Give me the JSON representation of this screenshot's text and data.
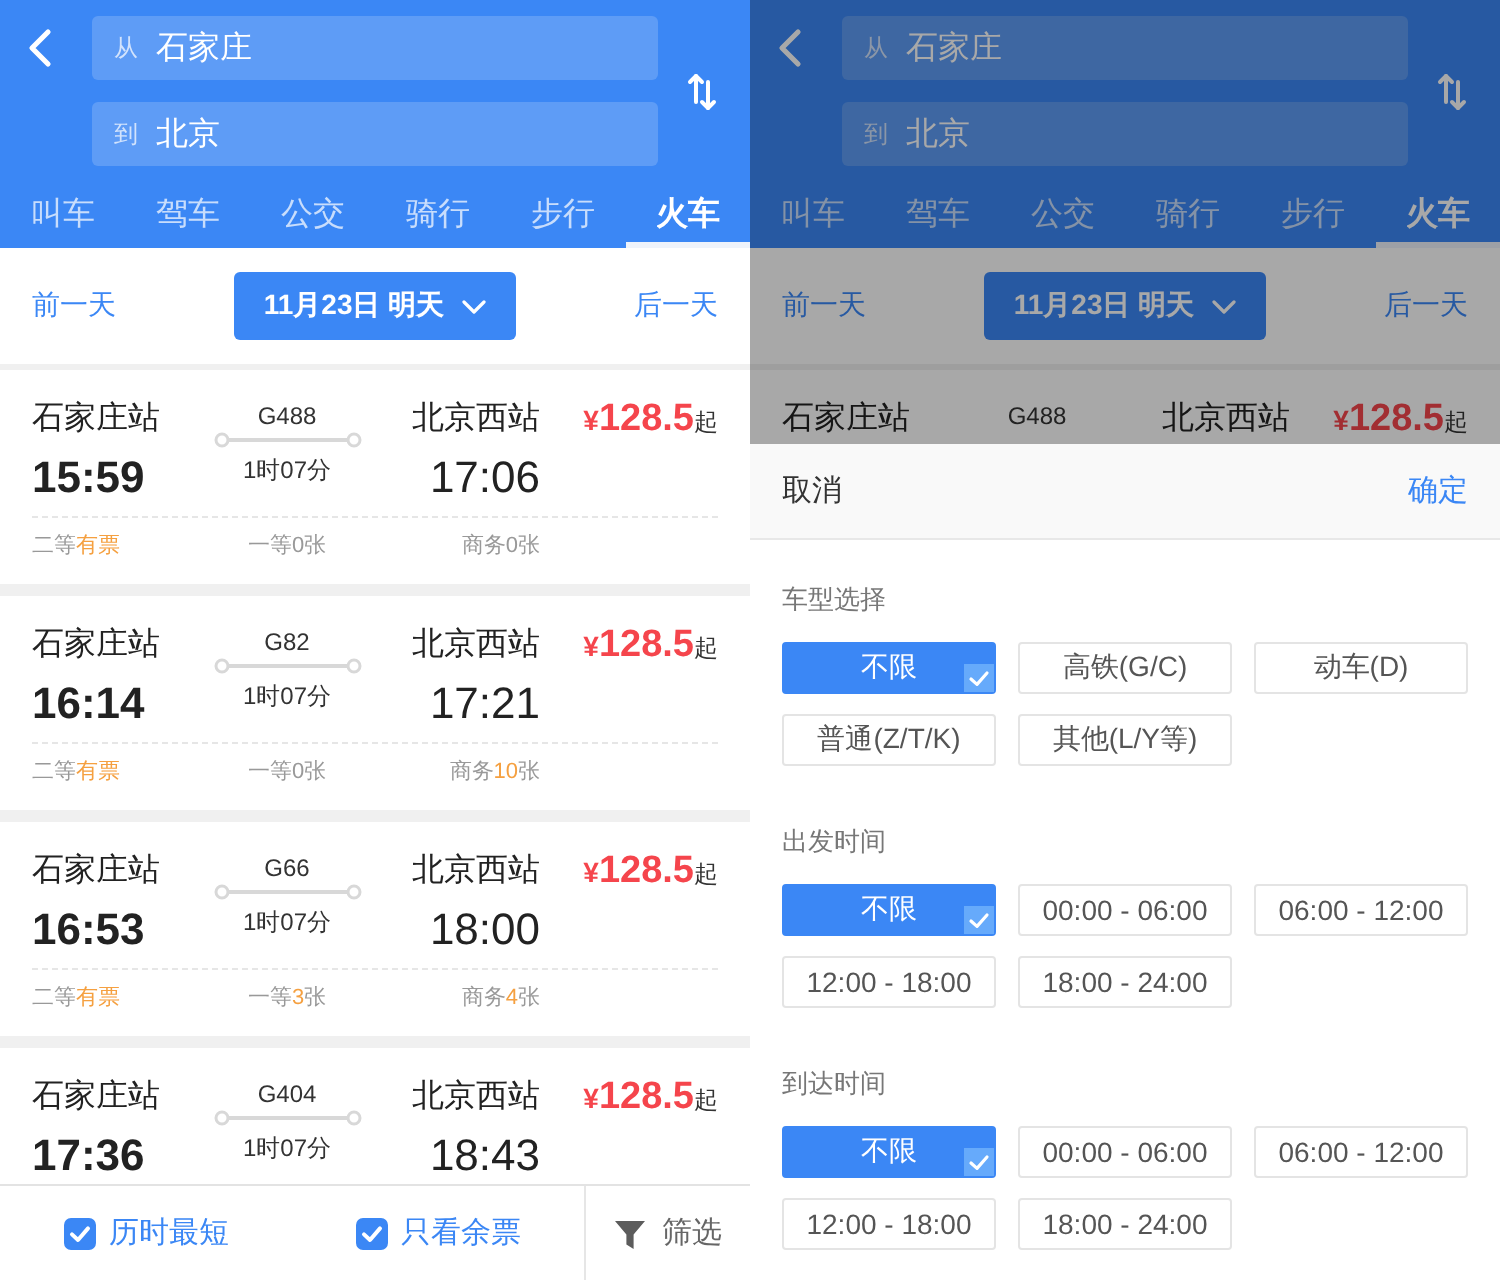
{
  "screens": [
    {
      "dimmed": false,
      "header": {
        "from": {
          "label": "从",
          "value": "石家庄"
        },
        "to": {
          "label": "到",
          "value": "北京"
        }
      },
      "tabs": [
        {
          "label": "叫车",
          "selected": false
        },
        {
          "label": "驾车",
          "selected": false
        },
        {
          "label": "公交",
          "selected": false
        },
        {
          "label": "骑行",
          "selected": false
        },
        {
          "label": "步行",
          "selected": false
        },
        {
          "label": "火车",
          "selected": true
        }
      ],
      "date_bar": {
        "prev": "前一天",
        "date": "11月23日 明天",
        "next": "后一天"
      },
      "trains": [
        {
          "from_station": "石家庄站",
          "depart": "15:59",
          "number": "G488",
          "duration": "1时07分",
          "to_station": "北京西站",
          "arrive": "17:06",
          "currency": "¥",
          "price": "128.5",
          "price_suffix": "起",
          "seats": [
            {
              "class": "二等",
              "count": "有票",
              "available": true
            },
            {
              "class": "一等",
              "count": "0",
              "unit": "张",
              "available": false
            },
            {
              "class": "商务",
              "count": "0",
              "unit": "张",
              "available": false
            }
          ]
        },
        {
          "from_station": "石家庄站",
          "depart": "16:14",
          "number": "G82",
          "duration": "1时07分",
          "to_station": "北京西站",
          "arrive": "17:21",
          "currency": "¥",
          "price": "128.5",
          "price_suffix": "起",
          "seats": [
            {
              "class": "二等",
              "count": "有票",
              "available": true
            },
            {
              "class": "一等",
              "count": "0",
              "unit": "张",
              "available": false
            },
            {
              "class": "商务",
              "count": "10",
              "unit": "张",
              "available": true
            }
          ]
        },
        {
          "from_station": "石家庄站",
          "depart": "16:53",
          "number": "G66",
          "duration": "1时07分",
          "to_station": "北京西站",
          "arrive": "18:00",
          "currency": "¥",
          "price": "128.5",
          "price_suffix": "起",
          "seats": [
            {
              "class": "二等",
              "count": "有票",
              "available": true
            },
            {
              "class": "一等",
              "count": "3",
              "unit": "张",
              "available": true
            },
            {
              "class": "商务",
              "count": "4",
              "unit": "张",
              "available": true
            }
          ]
        },
        {
          "from_station": "石家庄站",
          "depart": "17:36",
          "number": "G404",
          "duration": "1时07分",
          "to_station": "北京西站",
          "arrive": "18:43",
          "currency": "¥",
          "price": "128.5",
          "price_suffix": "起"
        }
      ],
      "bottom_bar": {
        "options": [
          {
            "label": "历时最短",
            "checked": true
          },
          {
            "label": "只看余票",
            "checked": true
          }
        ],
        "filter": "筛选"
      }
    },
    {
      "dimmed": true,
      "header": {
        "from": {
          "label": "从",
          "value": "石家庄"
        },
        "to": {
          "label": "到",
          "value": "北京"
        }
      },
      "tabs": [
        {
          "label": "叫车",
          "selected": false
        },
        {
          "label": "驾车",
          "selected": false
        },
        {
          "label": "公交",
          "selected": false
        },
        {
          "label": "骑行",
          "selected": false
        },
        {
          "label": "步行",
          "selected": false
        },
        {
          "label": "火车",
          "selected": true
        }
      ],
      "date_bar": {
        "prev": "前一天",
        "date": "11月23日 明天",
        "next": "后一天"
      },
      "trains": [
        {
          "from_station": "石家庄站",
          "number": "G488",
          "to_station": "北京西站",
          "currency": "¥",
          "price": "128.5",
          "price_suffix": "起"
        }
      ],
      "filter_sheet": {
        "cancel": "取消",
        "confirm": "确定",
        "sections": [
          {
            "title": "车型选择",
            "options": [
              {
                "label": "不限",
                "selected": true
              },
              {
                "label": "高铁(G/C)",
                "selected": false
              },
              {
                "label": "动车(D)",
                "selected": false
              },
              {
                "label": "普通(Z/T/K)",
                "selected": false
              },
              {
                "label": "其他(L/Y等)",
                "selected": false
              }
            ]
          },
          {
            "title": "出发时间",
            "options": [
              {
                "label": "不限",
                "selected": true
              },
              {
                "label": "00:00 - 06:00",
                "selected": false
              },
              {
                "label": "06:00 - 12:00",
                "selected": false
              },
              {
                "label": "12:00 - 18:00",
                "selected": false
              },
              {
                "label": "18:00 - 24:00",
                "selected": false
              }
            ]
          },
          {
            "title": "到达时间",
            "options": [
              {
                "label": "不限",
                "selected": true
              },
              {
                "label": "00:00 - 06:00",
                "selected": false
              },
              {
                "label": "06:00 - 12:00",
                "selected": false
              },
              {
                "label": "12:00 - 18:00",
                "selected": false
              },
              {
                "label": "18:00 - 24:00",
                "selected": false
              }
            ]
          }
        ]
      }
    }
  ]
}
